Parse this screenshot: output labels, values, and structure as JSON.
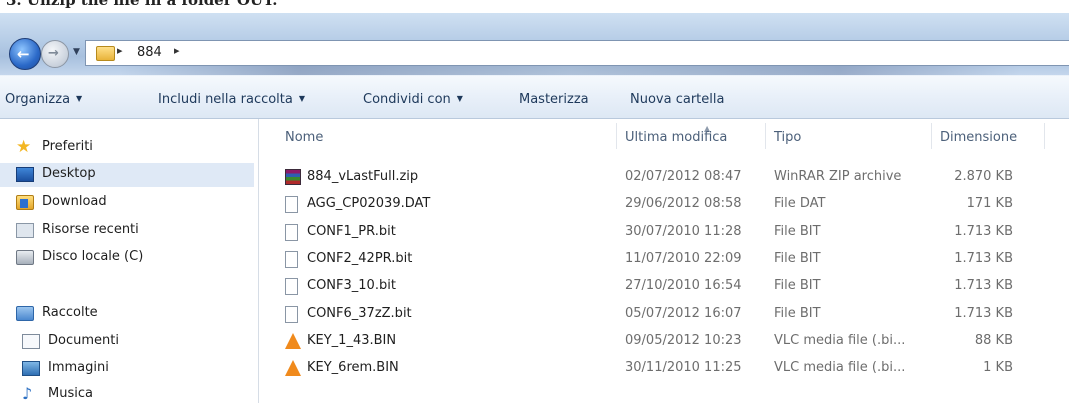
{
  "caption": "3. Unzip the file in a folder OUT.",
  "address_bar": {
    "back_glyph": "←",
    "forward_glyph": "→",
    "dropdown_glyph": "▼",
    "separator_glyph": "▸",
    "path": "884"
  },
  "toolbar": {
    "items": [
      {
        "label": "Organizza",
        "caret": "▼"
      },
      {
        "label": "Includi nella raccolta",
        "caret": "▼"
      },
      {
        "label": "Condividi con",
        "caret": "▼"
      },
      {
        "label": "Masterizza",
        "caret": ""
      },
      {
        "label": "Nuova cartella",
        "caret": ""
      }
    ]
  },
  "nav": {
    "favorites_label": "Preferiti",
    "favorites": [
      {
        "label": "Desktop",
        "icon": "desktop-icon"
      },
      {
        "label": "Download",
        "icon": "download-folder-icon"
      },
      {
        "label": "Risorse recenti",
        "icon": "recent-places-icon"
      },
      {
        "label": "Disco locale (C)",
        "icon": "local-disk-icon"
      }
    ],
    "libraries_label": "Raccolte",
    "libraries": [
      {
        "label": "Documenti",
        "icon": "documents-icon"
      },
      {
        "label": "Immagini",
        "icon": "pictures-icon"
      },
      {
        "label": "Musica",
        "icon": "music-icon"
      }
    ]
  },
  "columns": {
    "name": "Nome",
    "modified": "Ultima modifica",
    "type": "Tipo",
    "size": "Dimensione"
  },
  "files": [
    {
      "name": "884_vLastFull.zip",
      "modified": "02/07/2012 08:47",
      "type": "WinRAR ZIP archive",
      "size": "2.870 KB",
      "icon": "winrar-archive-icon"
    },
    {
      "name": "AGG_CP02039.DAT",
      "modified": "29/06/2012 08:58",
      "type": "File DAT",
      "size": "171 KB",
      "icon": "generic-file-icon"
    },
    {
      "name": "CONF1_PR.bit",
      "modified": "30/07/2010 11:28",
      "type": "File BIT",
      "size": "1.713 KB",
      "icon": "generic-file-icon"
    },
    {
      "name": "CONF2_42PR.bit",
      "modified": "11/07/2010 22:09",
      "type": "File BIT",
      "size": "1.713 KB",
      "icon": "generic-file-icon"
    },
    {
      "name": "CONF3_10.bit",
      "modified": "27/10/2010 16:54",
      "type": "File BIT",
      "size": "1.713 KB",
      "icon": "generic-file-icon"
    },
    {
      "name": "CONF6_37zZ.bit",
      "modified": "05/07/2012 16:07",
      "type": "File BIT",
      "size": "1.713 KB",
      "icon": "generic-file-icon"
    },
    {
      "name": "KEY_1_43.BIN",
      "modified": "09/05/2012 10:23",
      "type": "VLC media file (.bi...",
      "size": "88 KB",
      "icon": "vlc-media-icon"
    },
    {
      "name": "KEY_6rem.BIN",
      "modified": "30/11/2010 11:25",
      "type": "VLC media file (.bi...",
      "size": "1 KB",
      "icon": "vlc-media-icon"
    }
  ],
  "colors": {
    "selection": "#dfe9f6",
    "toolbar_text": "#1e395b",
    "meta_text": "#6d6d6d"
  }
}
